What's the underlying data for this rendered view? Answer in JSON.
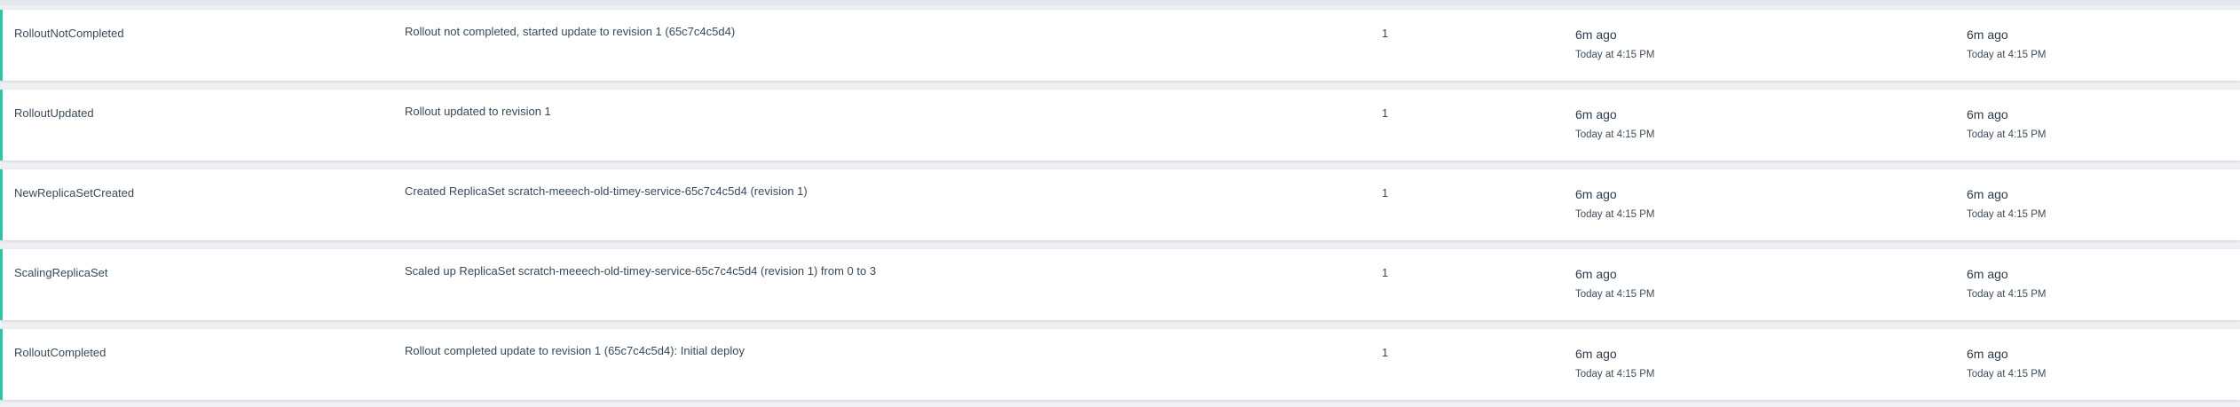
{
  "events": [
    {
      "reason": "RolloutNotCompleted",
      "message": "Rollout not completed, started update to revision 1 (65c7c4c5d4)",
      "count": "1",
      "first_seen": {
        "relative": "6m ago",
        "absolute": "Today at 4:15 PM"
      },
      "last_seen": {
        "relative": "6m ago",
        "absolute": "Today at 4:15 PM"
      }
    },
    {
      "reason": "RolloutUpdated",
      "message": "Rollout updated to revision 1",
      "count": "1",
      "first_seen": {
        "relative": "6m ago",
        "absolute": "Today at 4:15 PM"
      },
      "last_seen": {
        "relative": "6m ago",
        "absolute": "Today at 4:15 PM"
      }
    },
    {
      "reason": "NewReplicaSetCreated",
      "message": "Created ReplicaSet scratch-meeech-old-timey-service-65c7c4c5d4 (revision 1)",
      "count": "1",
      "first_seen": {
        "relative": "6m ago",
        "absolute": "Today at 4:15 PM"
      },
      "last_seen": {
        "relative": "6m ago",
        "absolute": "Today at 4:15 PM"
      }
    },
    {
      "reason": "ScalingReplicaSet",
      "message": "Scaled up ReplicaSet scratch-meeech-old-timey-service-65c7c4c5d4 (revision 1) from 0 to 3",
      "count": "1",
      "first_seen": {
        "relative": "6m ago",
        "absolute": "Today at 4:15 PM"
      },
      "last_seen": {
        "relative": "6m ago",
        "absolute": "Today at 4:15 PM"
      }
    },
    {
      "reason": "RolloutCompleted",
      "message": "Rollout completed update to revision 1 (65c7c4c5d4): Initial deploy",
      "count": "1",
      "first_seen": {
        "relative": "6m ago",
        "absolute": "Today at 4:15 PM"
      },
      "last_seen": {
        "relative": "6m ago",
        "absolute": "Today at 4:15 PM"
      }
    }
  ],
  "colors": {
    "row_accent": "#2ec4a6",
    "row_background": "#ffffff",
    "page_background": "#eef0f3",
    "text": "#394959"
  }
}
